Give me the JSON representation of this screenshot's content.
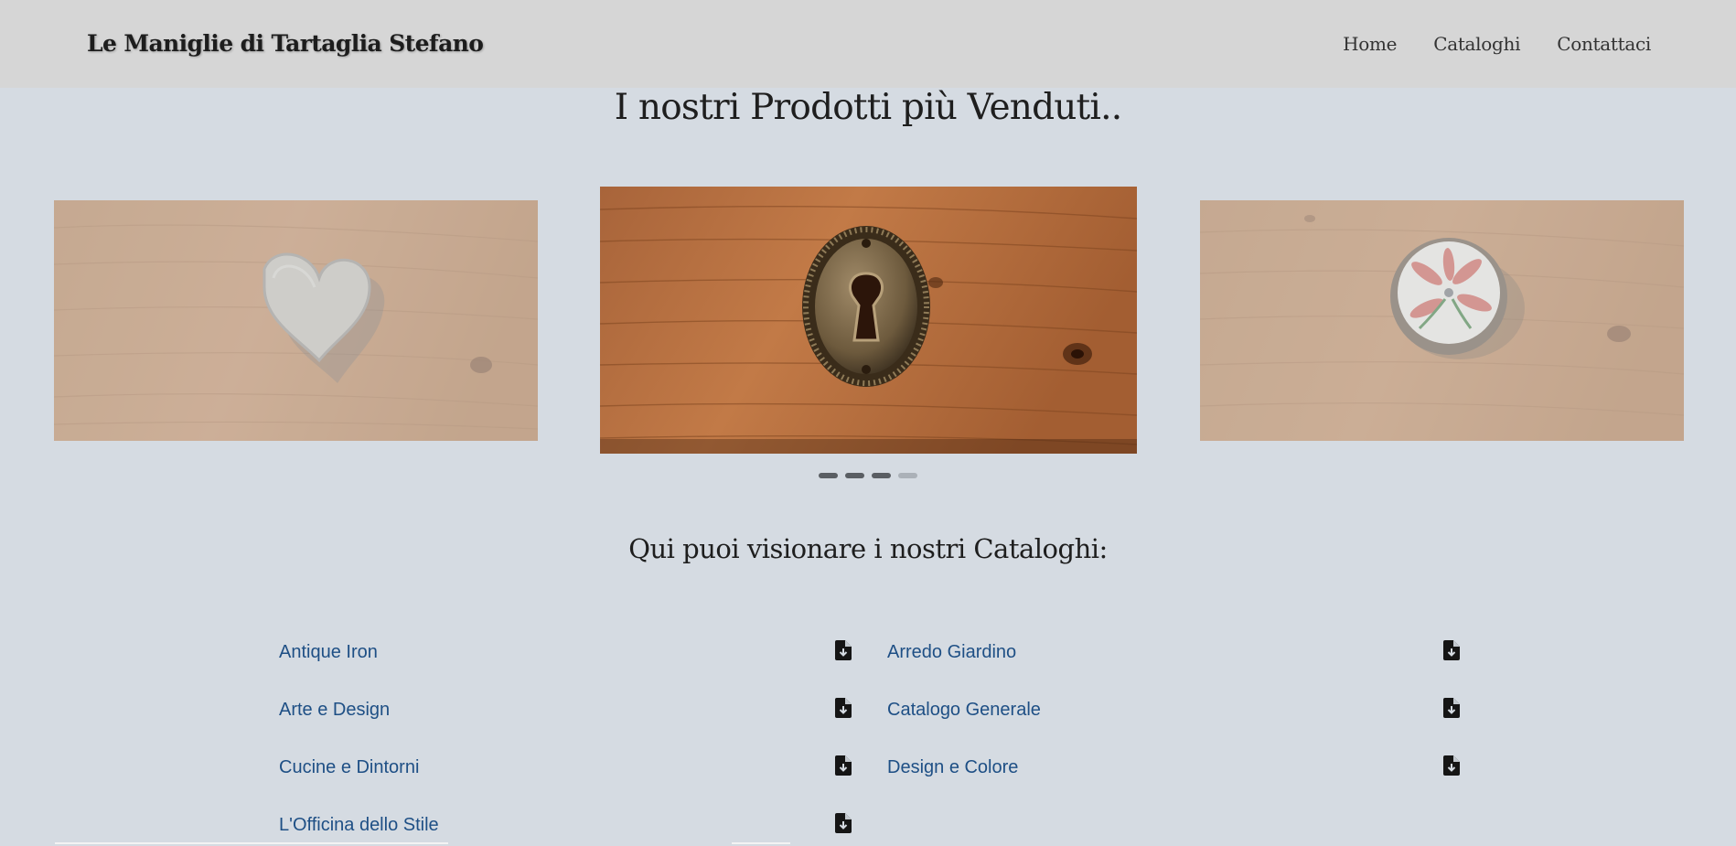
{
  "navbar": {
    "brand": "Le Maniglie di Tartaglia Stefano",
    "links": [
      "Home",
      "Cataloghi",
      "Contattaci"
    ]
  },
  "hero": {
    "title": "I nostri Prodotti più Venduti..",
    "slides": [
      {
        "subject": "heart-shaped metal knob on wood"
      },
      {
        "subject": "antique brass keyhole escutcheon on wood"
      },
      {
        "subject": "ceramic floral knob on wood"
      }
    ],
    "indicators": 4,
    "active_indicator": 3
  },
  "catalogs": {
    "title": "Qui puoi visionare i nostri Cataloghi:",
    "items": [
      {
        "label": "Antique Iron",
        "icon": "file-download-icon"
      },
      {
        "label": "Arredo Giardino",
        "icon": "file-download-icon"
      },
      {
        "label": "Arte e Design",
        "icon": "file-download-icon"
      },
      {
        "label": "Catalogo Generale",
        "icon": "file-download-icon"
      },
      {
        "label": "Cucine e Dintorni",
        "icon": "file-download-icon"
      },
      {
        "label": "Design e Colore",
        "icon": "file-download-icon"
      },
      {
        "label": "L'Officina dello Stile",
        "icon": "file-download-icon"
      }
    ]
  },
  "colors": {
    "page_background": "#d5dbe2",
    "navbar_background": "#d6d6d6",
    "link": "#1e4f85",
    "wood": "#b97a4a"
  }
}
